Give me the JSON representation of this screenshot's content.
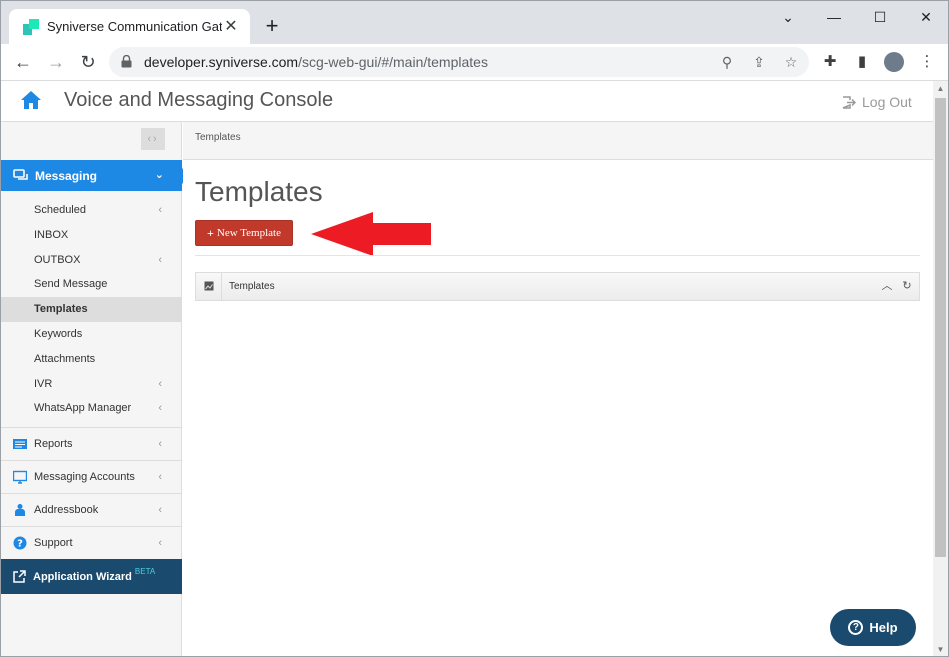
{
  "browser": {
    "tab_title": "Syniverse Communication Gatew",
    "url_host": "developer.syniverse.com",
    "url_path": "/scg-web-gui/#/main/templates"
  },
  "header": {
    "title": "Voice and Messaging Console",
    "logout": "Log Out"
  },
  "sidebar": {
    "messaging": "Messaging",
    "items": [
      {
        "label": "Scheduled",
        "arrow": "‹"
      },
      {
        "label": "INBOX",
        "arrow": ""
      },
      {
        "label": "OUTBOX",
        "arrow": "‹"
      },
      {
        "label": "Send Message",
        "arrow": ""
      },
      {
        "label": "Templates",
        "arrow": ""
      },
      {
        "label": "Keywords",
        "arrow": ""
      },
      {
        "label": "Attachments",
        "arrow": ""
      },
      {
        "label": "IVR",
        "arrow": "‹"
      },
      {
        "label": "WhatsApp Manager",
        "arrow": "‹"
      }
    ],
    "reports": "Reports",
    "messaging_accounts": "Messaging Accounts",
    "addressbook": "Addressbook",
    "support": "Support",
    "wizard": "Application Wizard",
    "wizard_badge": "BETA"
  },
  "main": {
    "breadcrumb": "Templates",
    "title": "Templates",
    "new_button": "New Template",
    "panel_title": "Templates"
  },
  "help": "Help",
  "colors": {
    "primary": "#1e88e5",
    "dark": "#1a4a6e",
    "danger": "#c0392b",
    "annotation_arrow": "#ed1c24"
  }
}
